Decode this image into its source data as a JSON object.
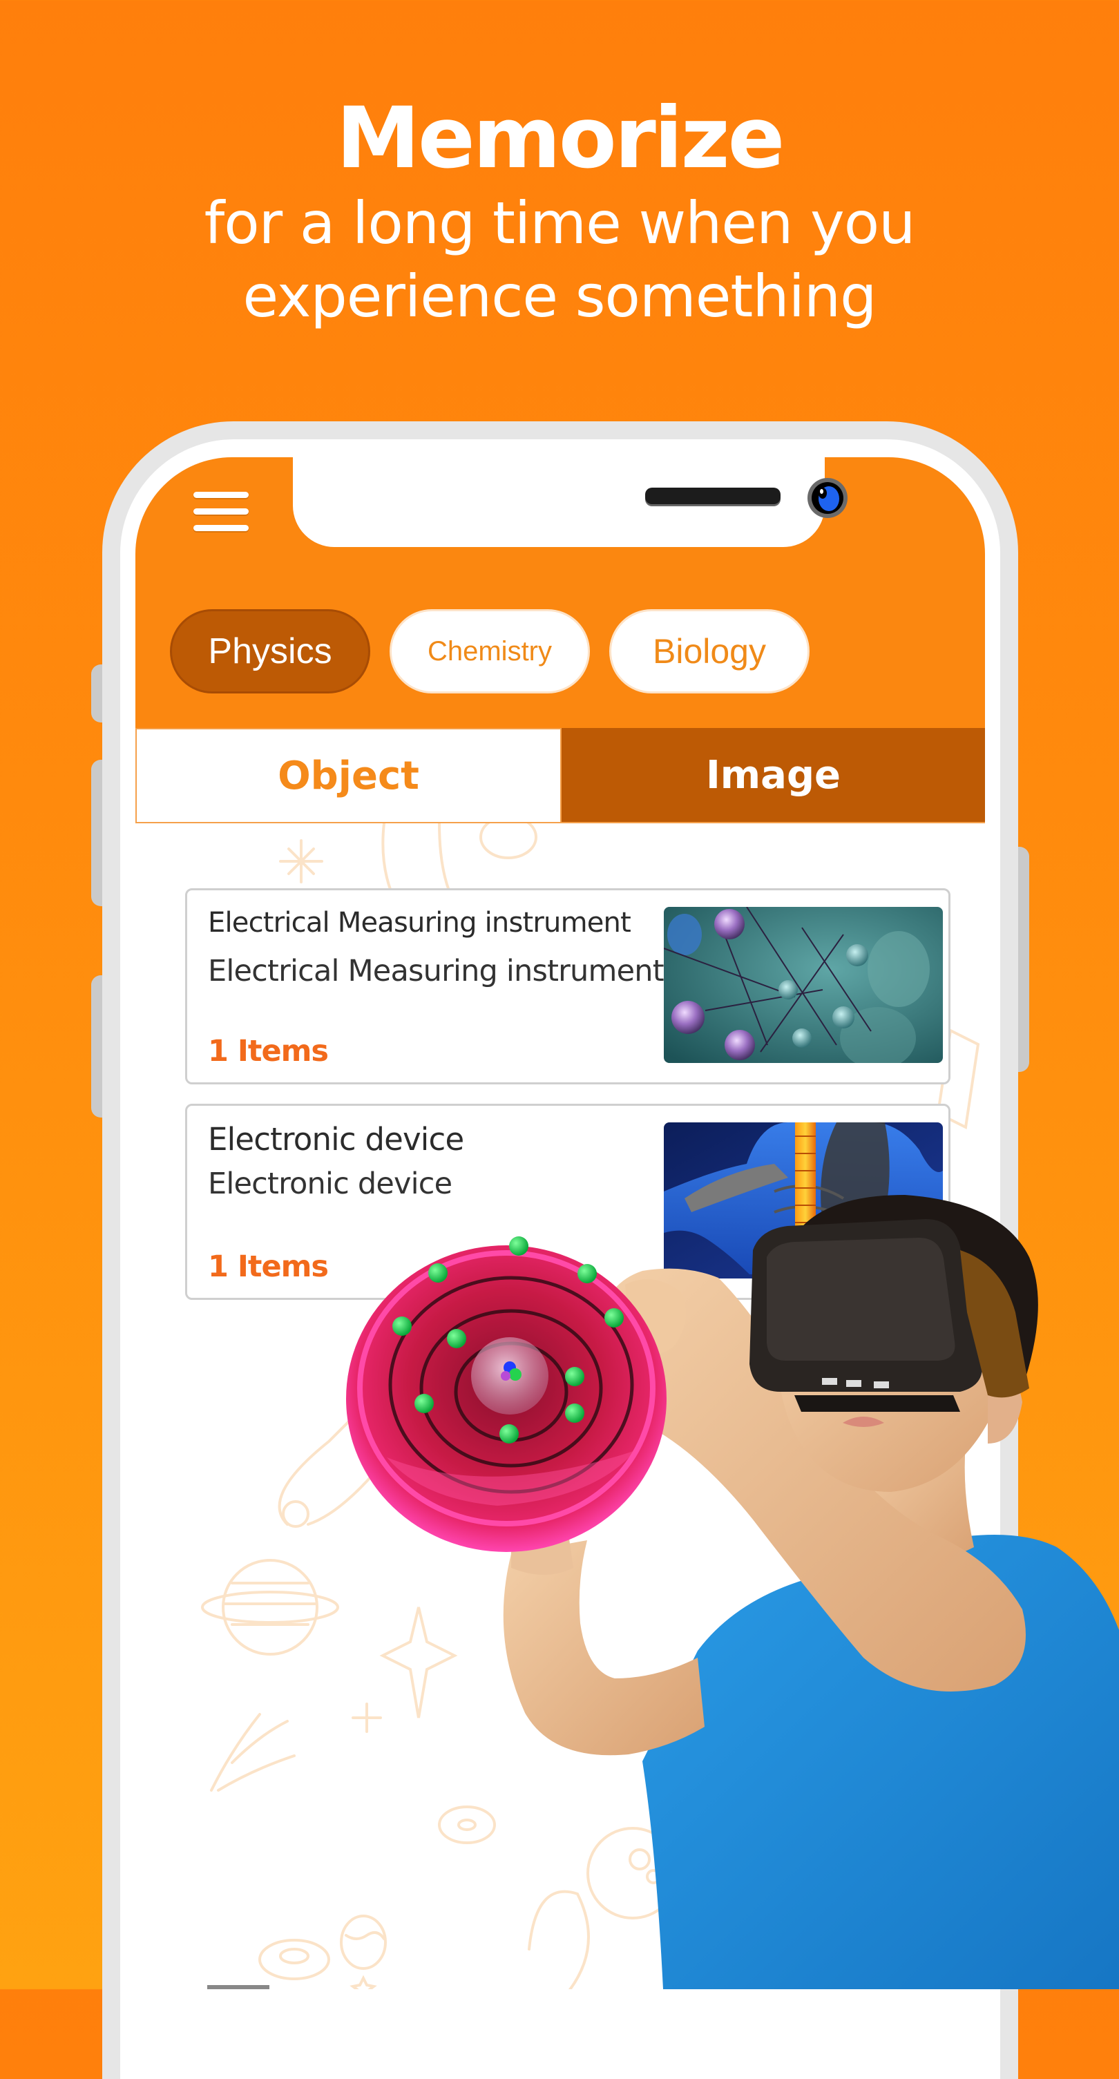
{
  "headline": {
    "title": "Memorize",
    "subtitle_line1": "for a long time when you",
    "subtitle_line2": "experience something"
  },
  "app": {
    "menu_icon": "hamburger-icon",
    "subjects": [
      {
        "label": "Physics",
        "selected": true
      },
      {
        "label": "Chemistry",
        "selected": false
      },
      {
        "label": "Biology",
        "selected": false
      }
    ],
    "tabs": [
      {
        "label": "Object",
        "selected": false
      },
      {
        "label": "Image",
        "selected": true
      }
    ],
    "cards": [
      {
        "title": "Electrical Measuring instrument",
        "description": "Electrical Measuring instrument",
        "count": "1 Items",
        "thumbnail": "3d-cells-molecule-image"
      },
      {
        "title": "Electronic device",
        "description": "Electronic device",
        "count": "1 Items",
        "thumbnail": "xray-spine-skeleton-image"
      }
    ]
  },
  "illustration": {
    "atom_model": "bohr-atom-3d-model",
    "person": "boy-wearing-vr-headset"
  },
  "colors": {
    "brand_orange": "#fb8710",
    "active_brown": "#bd5a05",
    "count_orange": "#f26a1b",
    "shirt_blue": "#1f8fd8",
    "atom_pink": "#e8266a",
    "electron_green": "#22c24a"
  }
}
